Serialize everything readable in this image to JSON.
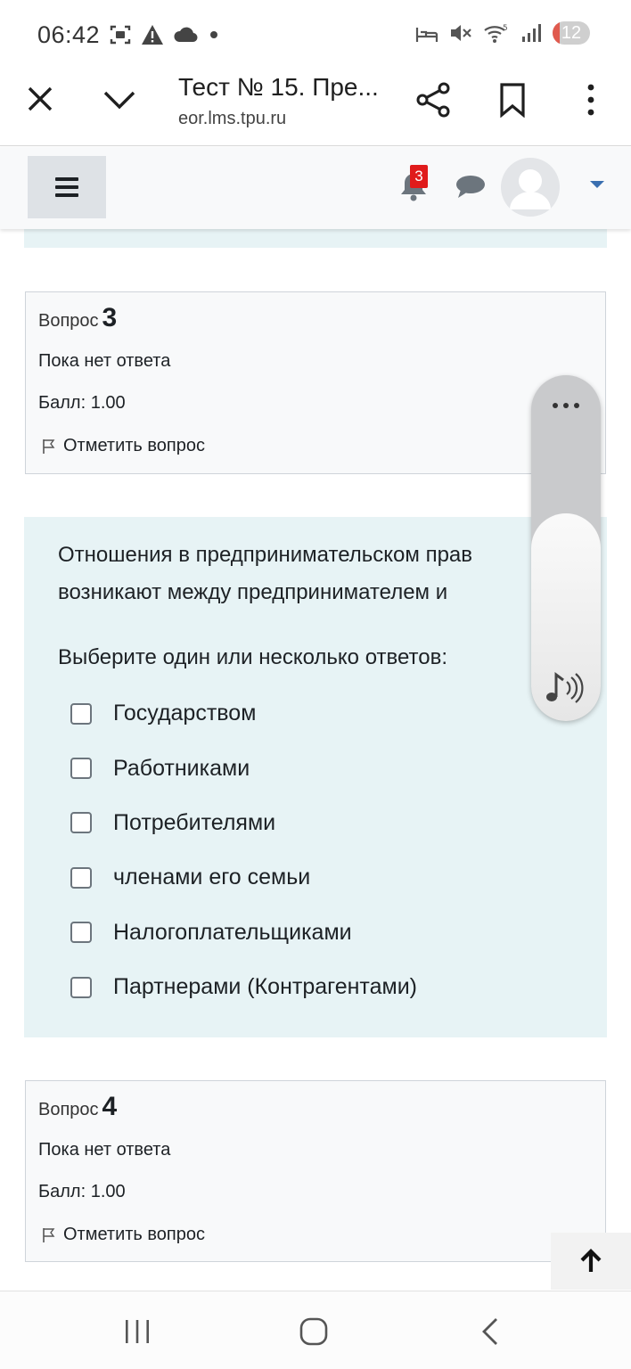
{
  "status_bar": {
    "time": "06:42",
    "battery": "12",
    "icons": [
      "screenshot-icon",
      "warning-icon",
      "cloud-icon",
      "dot-icon",
      "sleep-icon",
      "mute-icon",
      "wifi-icon",
      "signal-icon"
    ]
  },
  "browser": {
    "title": "Тест № 15. Пре...",
    "url": "eor.lms.tpu.ru"
  },
  "navbar": {
    "notification_count": "3"
  },
  "question3": {
    "label": "Вопрос",
    "number": "3",
    "state": "Пока нет ответа",
    "grade": "Балл: 1.00",
    "flag_label": "Отметить вопрос"
  },
  "question_text": {
    "line1": "Отношения в предпринимательском прав",
    "line2": "возникают между предпринимателем и",
    "prompt": "Выберите один или несколько ответов:",
    "answers": [
      {
        "label": "Государством",
        "checked": false
      },
      {
        "label": "Работниками",
        "checked": false
      },
      {
        "label": "Потребителями",
        "checked": false
      },
      {
        "label": "членами его семьи",
        "checked": false
      },
      {
        "label": "Налогоплательщиками",
        "checked": false
      },
      {
        "label": "Партнерами (Контрагентами)",
        "checked": false
      }
    ]
  },
  "question4": {
    "label": "Вопрос",
    "number": "4",
    "state": "Пока нет ответа",
    "grade": "Балл: 1.00",
    "flag_label": "Отметить вопрос"
  },
  "volume": {
    "level": 0.6
  },
  "colors": {
    "question_bg": "#e7f3f5",
    "info_bg": "#f8f9fa",
    "badge_red": "#e01b1b",
    "caret_blue": "#3a6fb0"
  }
}
